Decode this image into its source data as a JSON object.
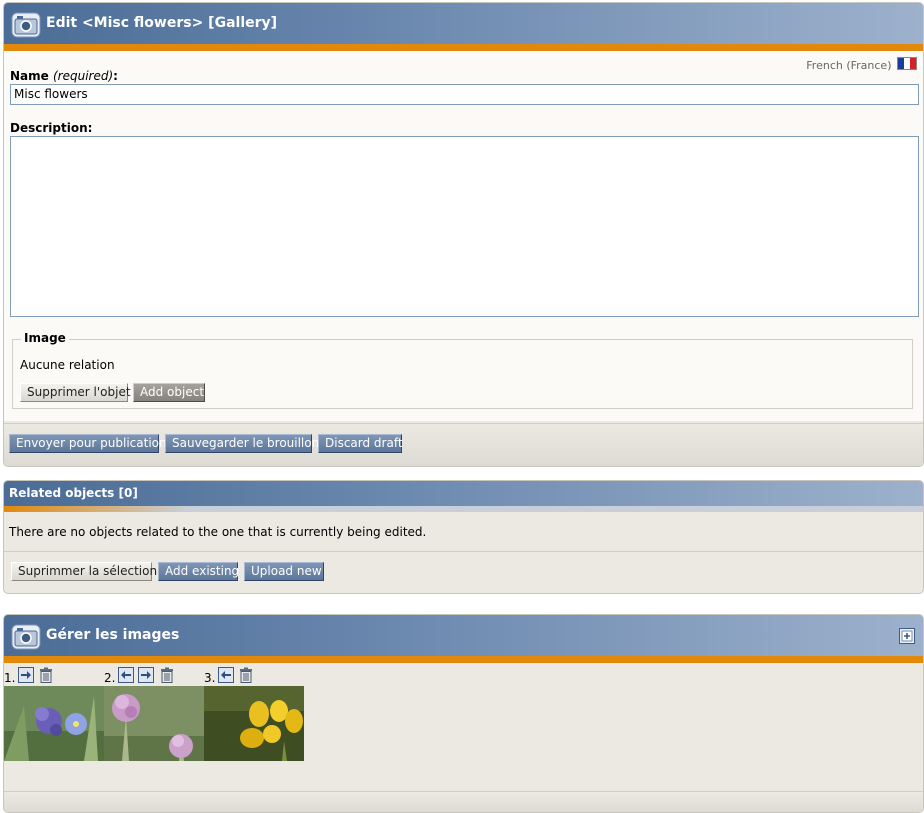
{
  "edit_panel": {
    "title": "Edit <Misc flowers> [Gallery]",
    "language": "French (France)",
    "name_label": "Name",
    "required_text": "(required)",
    "colon": ":",
    "name_value": "Misc flowers",
    "description_label": "Description:",
    "description_value": "",
    "image_fieldset": {
      "legend": "Image",
      "relation_text": "Aucune relation",
      "remove_button": "Supprimer l'objet",
      "add_button": "Add object"
    },
    "actions": {
      "publish": "Envoyer pour publication",
      "save_draft": "Sauvegarder le brouillon",
      "discard_draft": "Discard draft"
    }
  },
  "related_panel": {
    "title": "Related objects [0]",
    "empty_text": "There are no objects related to the one that is currently being edited.",
    "buttons": {
      "delete_selection": "Suprimmer la sélection",
      "add_existing": "Add existing",
      "upload_new": "Upload new"
    }
  },
  "images_panel": {
    "title": "Gérer les images",
    "items": [
      {
        "index": "1."
      },
      {
        "index": "2."
      },
      {
        "index": "3."
      }
    ]
  },
  "colors": {
    "header_blue": "#4a6c96",
    "orange": "#e2890c",
    "panel_bg": "#ebe9e1"
  }
}
